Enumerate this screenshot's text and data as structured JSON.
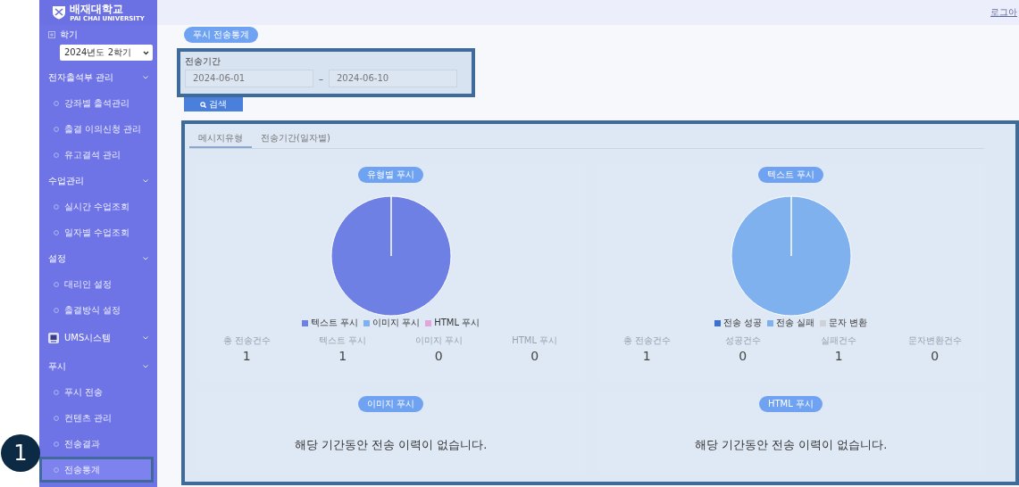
{
  "header": {
    "logo_title": "배재대학교",
    "logo_subtitle": "PAI CHAI UNIVERSITY",
    "logout": "로그아"
  },
  "sidebar": {
    "semester_label": "학기",
    "semester_select": "2024년도 2학기",
    "sections": [
      {
        "title": "전자출석부 관리",
        "kind": "group",
        "items": [
          {
            "label": "강좌별 출석관리",
            "selected": false
          },
          {
            "label": "출결 이의신청 관리",
            "selected": false
          },
          {
            "label": "유고결석 관리",
            "selected": false
          }
        ]
      },
      {
        "title": "수업관리",
        "kind": "group",
        "items": [
          {
            "label": "실시간 수업조회",
            "selected": false
          },
          {
            "label": "일자별 수업조회",
            "selected": false
          }
        ]
      },
      {
        "title": "설정",
        "kind": "group",
        "items": [
          {
            "label": "대리인 설정",
            "selected": false
          },
          {
            "label": "출결방식 설정",
            "selected": false
          }
        ]
      },
      {
        "title": "UMS시스템",
        "kind": "system"
      },
      {
        "title": "푸시",
        "kind": "group",
        "items": [
          {
            "label": "푸시 전송",
            "selected": false
          },
          {
            "label": "컨텐츠 관리",
            "selected": false
          },
          {
            "label": "전송결과",
            "selected": false
          },
          {
            "label": "전송통계",
            "selected": true
          }
        ]
      }
    ]
  },
  "page_button": "푸시 전송통계",
  "filter": {
    "label": "전송기간",
    "start": "2024-06-01",
    "separator": "–",
    "end": "2024-06-10",
    "highlighted": true
  },
  "search_button": "검색",
  "tab_panel": {
    "highlighted": true,
    "tabs": [
      {
        "label": "메시지유형",
        "selected": true
      },
      {
        "label": "전송기간(일자별)",
        "selected": false
      }
    ],
    "cards": [
      {
        "kind": "chart",
        "title": "유형별 푸시",
        "chart_data": {
          "type": "pie",
          "categories": [
            "텍스트 푸시",
            "이미지 푸시",
            "HTML 푸시"
          ],
          "values": [
            1,
            0,
            0
          ],
          "colors": [
            "#6f80e4",
            "#7fb1ee",
            "#e3a6dc"
          ]
        },
        "stats": [
          {
            "label": "총 전송건수",
            "value": "1"
          },
          {
            "label": "텍스트 푸시",
            "value": "1"
          },
          {
            "label": "이미지 푸시",
            "value": "0"
          },
          {
            "label": "HTML 푸시",
            "value": "0"
          }
        ]
      },
      {
        "kind": "chart",
        "title": "텍스트 푸시",
        "chart_data": {
          "type": "pie",
          "categories": [
            "전송 성공",
            "전송 실패",
            "문자 변환"
          ],
          "values": [
            0,
            1,
            0
          ],
          "colors": [
            "#3b6fd0",
            "#7fb1ee",
            "#cfd3d8"
          ]
        },
        "stats": [
          {
            "label": "총 전송건수",
            "value": "1"
          },
          {
            "label": "성공건수",
            "value": "0"
          },
          {
            "label": "실패건수",
            "value": "1"
          },
          {
            "label": "문자변환건수",
            "value": "0"
          }
        ]
      },
      {
        "kind": "empty",
        "title": "이미지 푸시",
        "message": "해당 기간동안 전송 이력이 없습니다."
      },
      {
        "kind": "empty",
        "title": "HTML 푸시",
        "message": "해당 기간동안 전송 이력이 없습니다."
      }
    ]
  },
  "callout": "1"
}
